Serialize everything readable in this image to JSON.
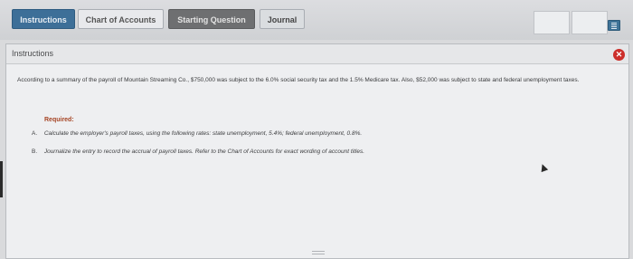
{
  "tabs": {
    "instructions": "Instructions",
    "chart_of_accounts": "Chart of Accounts",
    "starting_question": "Starting Question",
    "journal": "Journal"
  },
  "panel": {
    "title": "Instructions",
    "close_symbol": "✕",
    "body_text": "According to a summary of the payroll of Mountain Streaming Co., $750,000 was subject to the 6.0% social security tax and the 1.5% Medicare tax. Also, $52,000 was subject to state and federal unemployment taxes.",
    "required_label": "Required:",
    "items": [
      {
        "letter": "A.",
        "text": "Calculate the employer's payroll taxes, using the following rates: state unemployment, 5.4%; federal unemployment, 0.8%."
      },
      {
        "letter": "B.",
        "text": "Journalize the entry to record the accrual of payroll taxes. Refer to the Chart of Accounts for exact wording of account titles."
      }
    ]
  },
  "icons": {
    "menu": "hamburger-menu-icon",
    "close": "close-icon",
    "cursor": "mouse-cursor-icon"
  },
  "colors": {
    "active_tab": "#3d6f98",
    "starting_question_tab": "#6e6f71",
    "close_button": "#cc2e2a",
    "required_label": "#a64424"
  }
}
